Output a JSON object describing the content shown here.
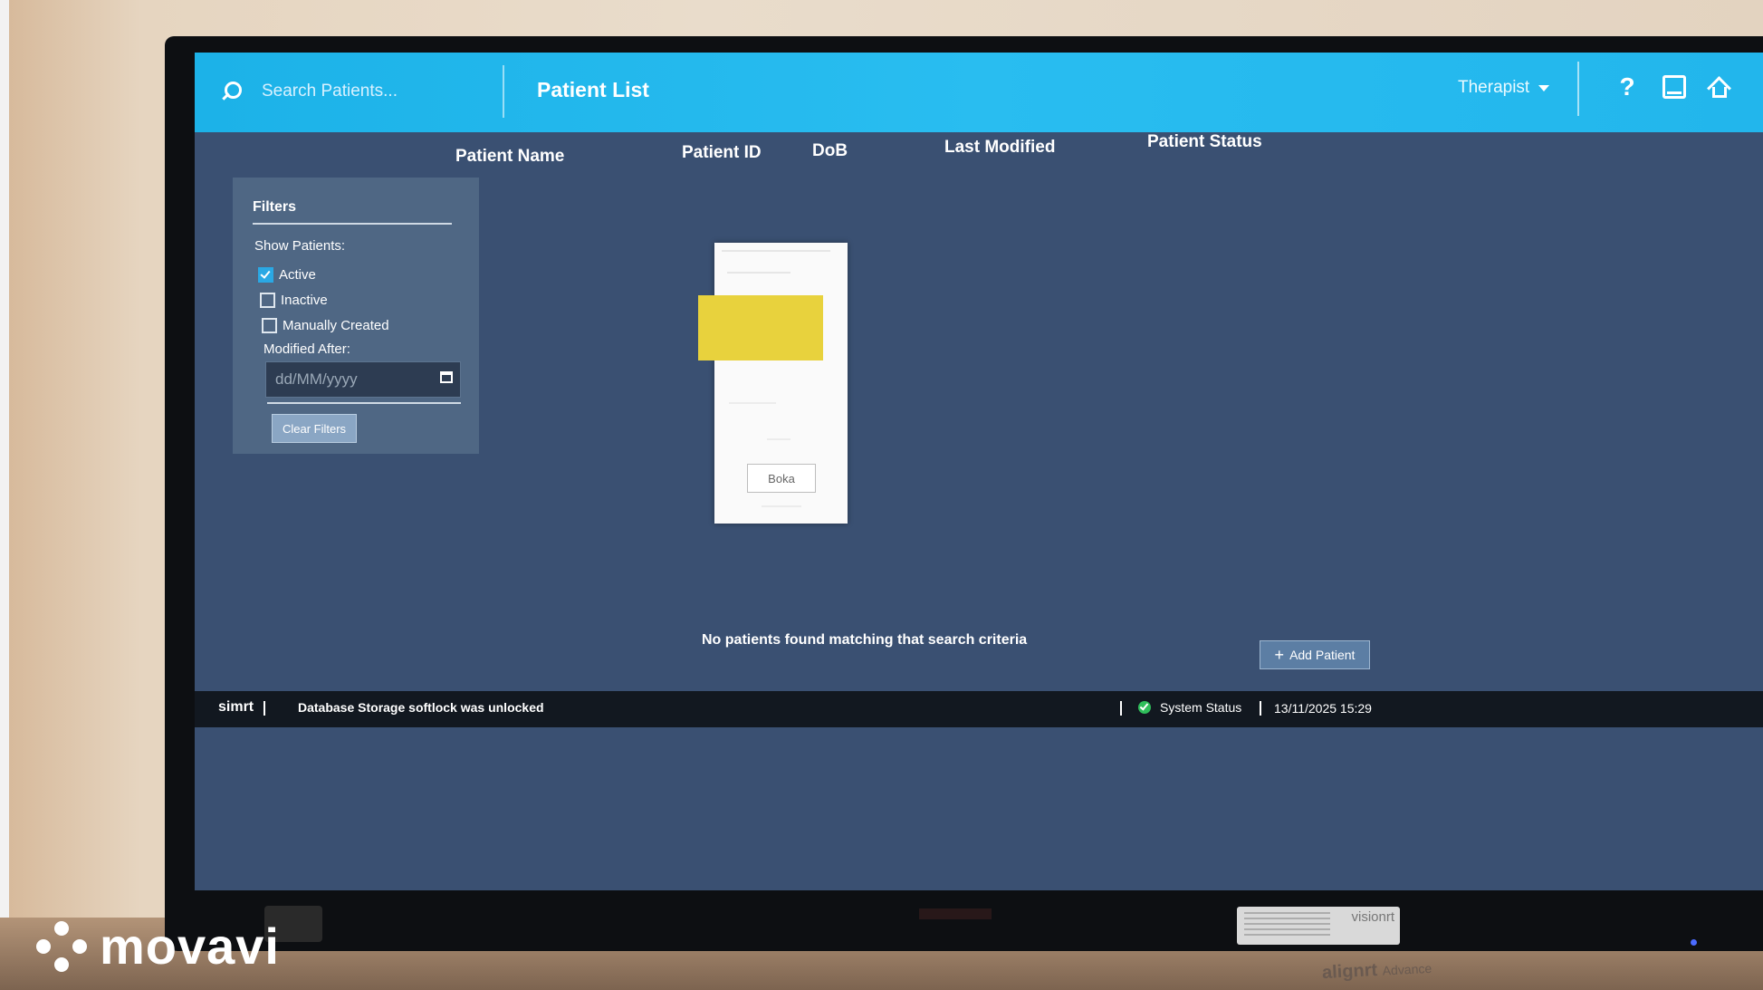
{
  "topbar": {
    "search_placeholder": "Search Patients...",
    "page_title": "Patient List",
    "role": "Therapist",
    "help_label": "?"
  },
  "table": {
    "columns": [
      "Patient Name",
      "Patient ID",
      "DoB",
      "Last Modified",
      "Patient Status"
    ],
    "empty_message": "No patients found matching that search criteria"
  },
  "filters": {
    "title": "Filters",
    "show_label": "Show Patients:",
    "options": [
      {
        "label": "Active",
        "checked": true
      },
      {
        "label": "Inactive",
        "checked": false
      },
      {
        "label": "Manually Created",
        "checked": false
      }
    ],
    "modified_label": "Modified After:",
    "date_placeholder": "dd/MM/yyyy",
    "clear_label": "Clear Filters"
  },
  "overlay_card": {
    "button_label": "Boka"
  },
  "actions": {
    "add_patient_label": "Add Patient"
  },
  "statusbar": {
    "brand": "simrt",
    "message": "Database Storage softlock was unlocked",
    "system_status": "System Status",
    "datetime": "13/11/2025 15:29"
  },
  "hardware": {
    "sticker_brand": "visionrt",
    "alignrt_label": "alignrt",
    "alignrt_sub": "Advance"
  },
  "watermark": {
    "text": "movavi"
  },
  "colors": {
    "topbar": "#29bdf0",
    "background": "#3a5072",
    "status_ok": "#2fbd5a"
  }
}
